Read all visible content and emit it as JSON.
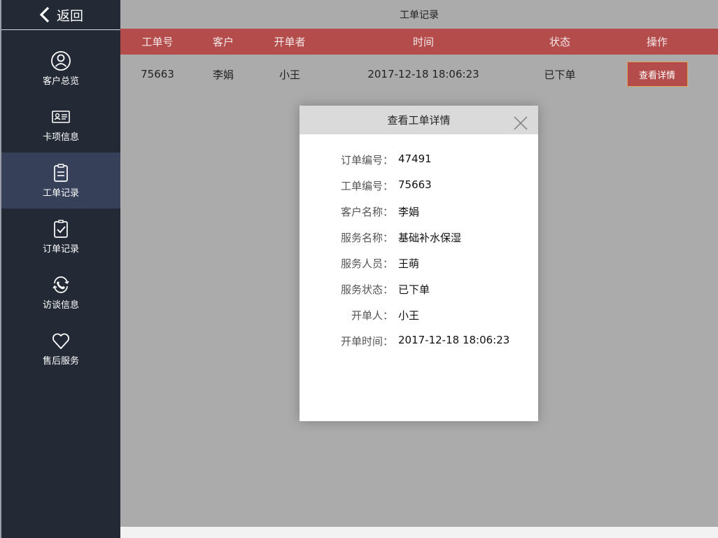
{
  "sidebar": {
    "back_label": "返回",
    "items": [
      {
        "label": "客户总览",
        "icon": "user-icon"
      },
      {
        "label": "卡项信息",
        "icon": "card-icon"
      },
      {
        "label": "工单记录",
        "icon": "clipboard-icon"
      },
      {
        "label": "订单记录",
        "icon": "clipboard-check-icon"
      },
      {
        "label": "访谈信息",
        "icon": "phone-icon"
      },
      {
        "label": "售后服务",
        "icon": "heart-icon"
      }
    ],
    "active_index": 2
  },
  "page": {
    "title": "工单记录"
  },
  "table": {
    "headers": [
      "工单号",
      "客户",
      "开单者",
      "时间",
      "状态",
      "操作"
    ],
    "rows": [
      {
        "id": "75663",
        "customer": "李娟",
        "creator": "小王",
        "time": "2017-12-18 18:06:23",
        "status": "已下单",
        "action": "查看详情"
      }
    ]
  },
  "modal": {
    "title": "查看工单详情",
    "fields": [
      {
        "label": "订单编号：",
        "value": "47491"
      },
      {
        "label": "工单编号：",
        "value": "75663"
      },
      {
        "label": "客户名称：",
        "value": "李娟"
      },
      {
        "label": "服务名称：",
        "value": "基础补水保湿"
      },
      {
        "label": "服务人员：",
        "value": "王萌"
      },
      {
        "label": "服务状态：",
        "value": "已下单"
      },
      {
        "label": "开单人：",
        "value": "小王"
      },
      {
        "label": "开单时间：",
        "value": "2017-12-18 18:06:23"
      }
    ]
  },
  "colors": {
    "sidebar_bg": "#232a35",
    "sidebar_active": "#364059",
    "accent_red": "#b44c4c",
    "overlay_gray": "#ababab"
  }
}
